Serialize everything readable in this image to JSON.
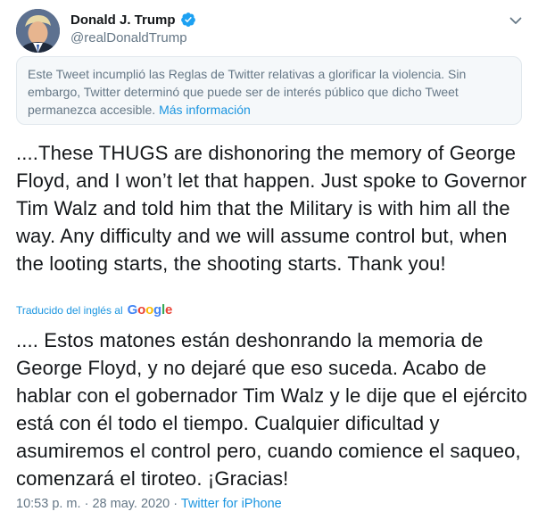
{
  "author": {
    "display_name": "Donald J. Trump",
    "handle": "@realDonaldTrump"
  },
  "icons": {
    "avatar": "profile-photo",
    "verified": "verified-badge-icon",
    "menu": "chevron-down-icon"
  },
  "notice": {
    "text": "Este Tweet incumplió las Reglas de Twitter relativas a glorificar la violencia. Sin embargo, Twitter determinó que puede ser de interés público que dicho Tweet permanezca accesible.",
    "link": "Más información"
  },
  "tweet": {
    "original": "....These THUGS are dishonoring the memory of George Floyd, and I won’t let that happen. Just spoke to Governor Tim Walz and told him that the Military is with him all the way. Any difficulty and we will assume control but, when the looting starts, the shooting starts. Thank you!",
    "translated_by": "Traducido del inglés al",
    "translator": "Google",
    "translation": ".... Estos matones están deshonrando la memoria de George Floyd, y no dejaré que eso suceda. Acabo de hablar con el gobernador Tim Walz y le dije que el ejército está con él todo el tiempo. Cualquier dificultad y asumiremos el control pero, cuando comience el saqueo, comenzará el tiroteo. ¡Gracias!"
  },
  "meta": {
    "time": "10:53 p. m.",
    "separator": "·",
    "date": "28 may. 2020",
    "source": "Twitter for iPhone"
  },
  "colors": {
    "link": "#1b95e0",
    "secondary_text": "#657786",
    "notice_background": "#f5f8fa"
  }
}
